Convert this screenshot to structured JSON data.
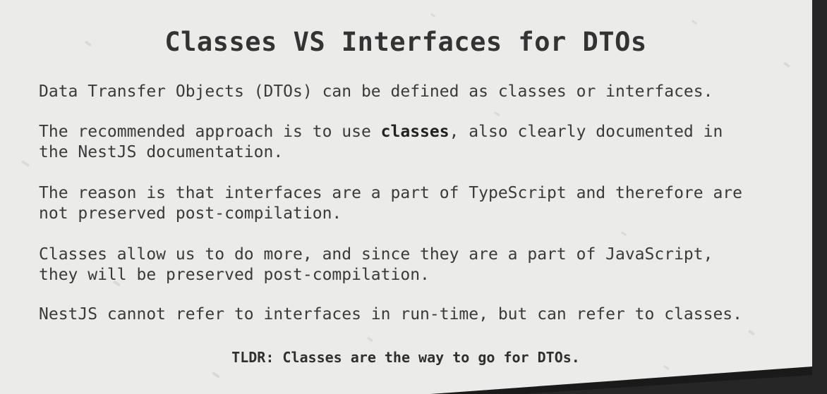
{
  "slide": {
    "title": "Classes VS Interfaces for DTOs",
    "paragraphs": {
      "p1": "Data Transfer Objects (DTOs) can be defined as classes or interfaces.",
      "p2_before": "The recommended approach is to use ",
      "p2_bold": "classes",
      "p2_after": ", also clearly documented in\nthe NestJS documentation.",
      "p3": "The reason is that interfaces are a part of TypeScript and therefore are\nnot preserved post-compilation.",
      "p4": "Classes allow us to do more, and since they are a part of JavaScript,\nthey will be preserved post-compilation.",
      "p5": "NestJS cannot refer to interfaces in run-time, but can refer to classes."
    },
    "tldr": "TLDR: Classes are the way to go for DTOs."
  },
  "colors": {
    "paper": "#ebebea",
    "text": "#333333",
    "background": "#262626"
  }
}
